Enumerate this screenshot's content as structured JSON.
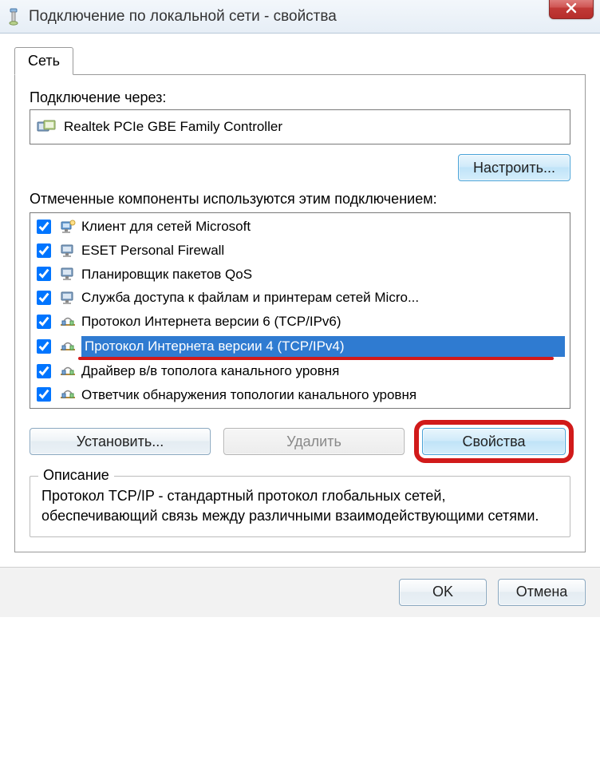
{
  "window": {
    "title": "Подключение по локальной сети - свойства"
  },
  "tab": {
    "label": "Сеть"
  },
  "connect_through": {
    "label": "Подключение через:",
    "adapter": "Realtek PCIe GBE Family Controller"
  },
  "configure_btn": "Настроить...",
  "components_label": "Отмеченные компоненты используются этим подключением:",
  "components": [
    {
      "label": "Клиент для сетей Microsoft",
      "checked": true,
      "icon": "client"
    },
    {
      "label": "ESET Personal Firewall",
      "checked": true,
      "icon": "monitor"
    },
    {
      "label": "Планировщик пакетов QoS",
      "checked": true,
      "icon": "monitor"
    },
    {
      "label": "Служба доступа к файлам и принтерам сетей Micro...",
      "checked": true,
      "icon": "monitor"
    },
    {
      "label": "Протокол Интернета версии 6 (TCP/IPv6)",
      "checked": true,
      "icon": "protocol"
    },
    {
      "label": "Протокол Интернета версии 4 (TCP/IPv4)",
      "checked": true,
      "icon": "protocol",
      "selected": true,
      "underline": true
    },
    {
      "label": "Драйвер в/в тополога канального уровня",
      "checked": true,
      "icon": "protocol"
    },
    {
      "label": "Ответчик обнаружения топологии канального уровня",
      "checked": true,
      "icon": "protocol"
    }
  ],
  "buttons": {
    "install": "Установить...",
    "remove": "Удалить",
    "properties": "Свойства"
  },
  "description": {
    "legend": "Описание",
    "text": "Протокол TCP/IP - стандартный протокол глобальных сетей, обеспечивающий связь между различными взаимодействующими сетями."
  },
  "footer": {
    "ok": "OK",
    "cancel": "Отмена"
  }
}
